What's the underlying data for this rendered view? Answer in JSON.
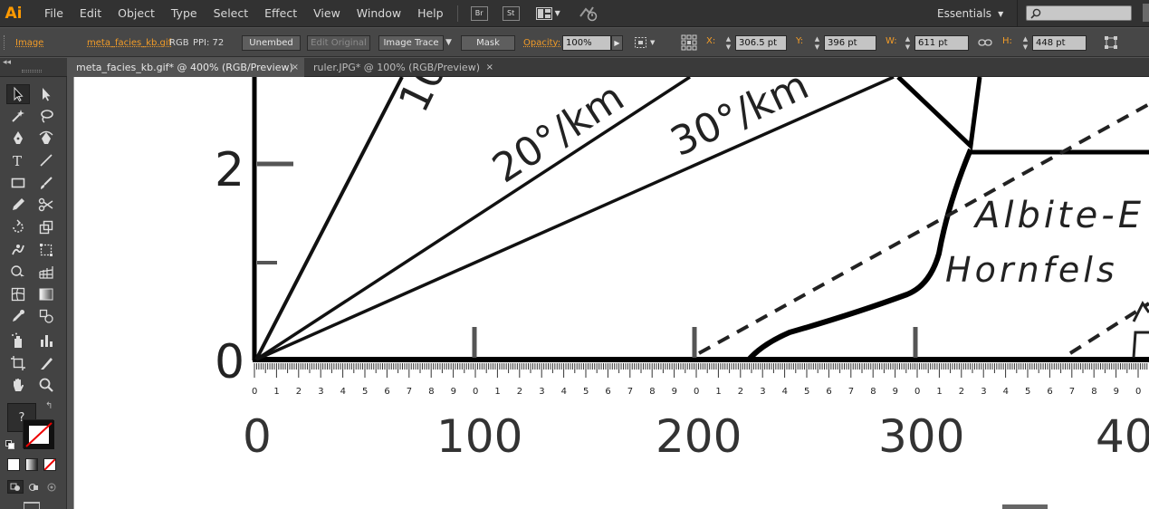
{
  "app": {
    "logo": "Ai"
  },
  "menu": {
    "items": [
      "File",
      "Edit",
      "Object",
      "Type",
      "Select",
      "Effect",
      "View",
      "Window",
      "Help"
    ],
    "bridge_label": "Br",
    "stock_label": "St",
    "workspace": "Essentials",
    "search_placeholder": ""
  },
  "control_bar": {
    "selection_type": "Image",
    "filename": "meta_facies_kb.gif",
    "color_mode": "RGB",
    "ppi": "PPI: 72",
    "embed_button": "Unembed",
    "edit_original_button": "Edit Original",
    "image_trace_button": "Image Trace",
    "mask_button": "Mask",
    "opacity_label": "Opacity:",
    "opacity_value": "100%",
    "x_label": "X:",
    "x_value": "306.5 pt",
    "y_label": "Y:",
    "y_value": "396 pt",
    "w_label": "W:",
    "w_value": "611 pt",
    "h_label": "H:",
    "h_value": "448 pt"
  },
  "tabs": [
    {
      "label": "meta_facies_kb.gif* @ 400% (RGB/Preview)",
      "close": "×",
      "active": true
    },
    {
      "label": "ruler.JPG* @ 100% (RGB/Preview)",
      "close": "×",
      "active": false
    }
  ],
  "panel_collapse": "◂◂",
  "tools": {
    "unknown_label": "?",
    "icons": [
      "selection-icon",
      "direct-selection-icon",
      "magic-wand-icon",
      "lasso-icon",
      "pen-icon",
      "curvature-icon",
      "type-icon",
      "line-icon",
      "rectangle-icon",
      "paintbrush-icon",
      "pencil-icon",
      "scissors-icon",
      "rotate-icon",
      "scale-icon",
      "warp-icon",
      "free-transform-icon",
      "shape-builder-icon",
      "perspective-grid-icon",
      "mesh-icon",
      "gradient-icon",
      "eyedropper-icon",
      "blend-icon",
      "symbol-sprayer-icon",
      "column-graph-icon",
      "artboard-icon",
      "slice-icon",
      "hand-icon",
      "zoom-icon"
    ]
  },
  "artwork": {
    "y_ticks": [
      "2",
      "0"
    ],
    "gradient_labels": [
      "10",
      "20°/km",
      "30°/km"
    ],
    "facies_labels": [
      "Albite-E",
      "Hornfels"
    ],
    "ruler_minor_digits": [
      "0",
      "1",
      "2",
      "3",
      "4",
      "5",
      "6",
      "7",
      "8",
      "9"
    ],
    "x_ticks": [
      "0",
      "100",
      "200",
      "300",
      "40"
    ]
  },
  "colors": {
    "accent_orange": "#f39c27",
    "menubar_bg": "#323232",
    "panel_bg": "#474747",
    "canvas_bg": "#ffffff"
  }
}
